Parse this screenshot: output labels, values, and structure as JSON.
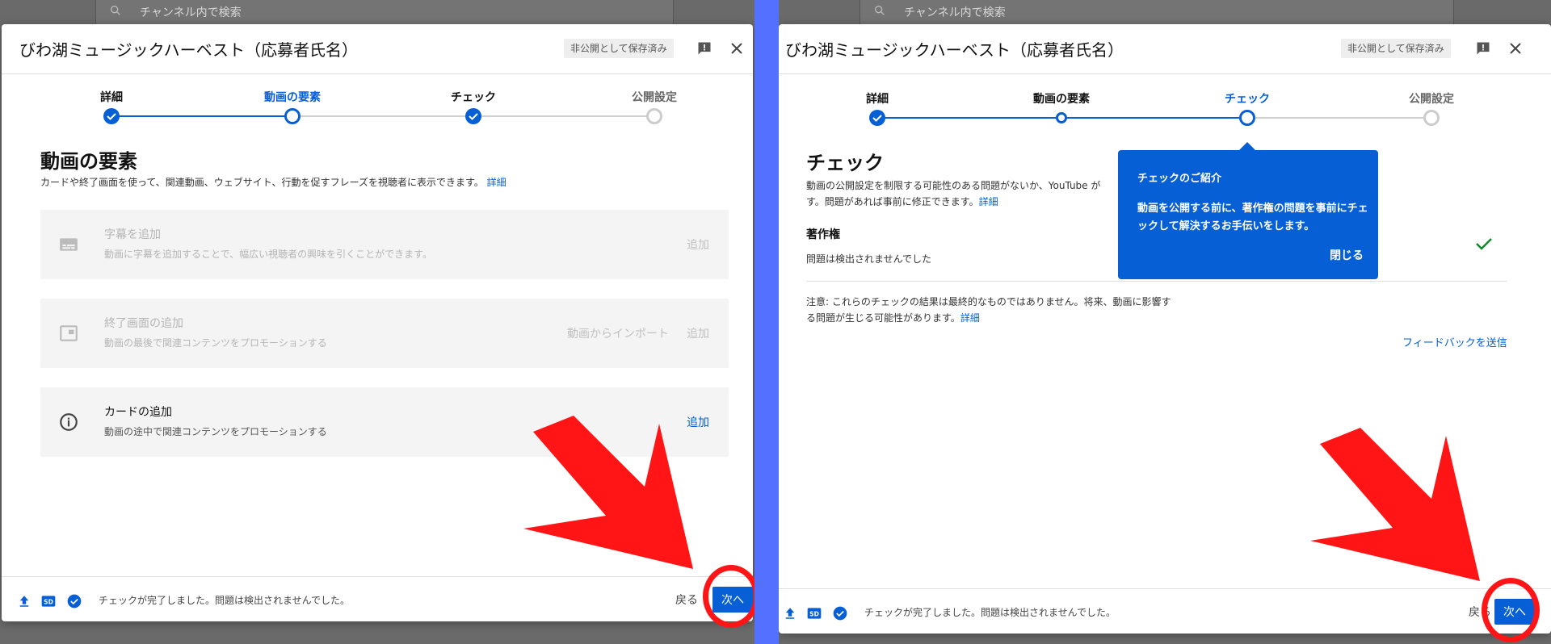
{
  "background": {
    "search_placeholder": "チャンネル内で検索"
  },
  "left": {
    "dialog_title": "びわ湖ミュージックハーベスト（応募者氏名）",
    "saved_badge": "非公開として保存済み",
    "steps": [
      {
        "label": "詳細",
        "state": "done"
      },
      {
        "label": "動画の要素",
        "state": "current"
      },
      {
        "label": "チェック",
        "state": "done"
      },
      {
        "label": "公開設定",
        "state": "pending"
      }
    ],
    "section_title": "動画の要素",
    "section_desc": "カードや終了画面を使って、関連動画、ウェブサイト、行動を促すフレーズを視聴者に表示できます。",
    "section_desc_link": "詳細",
    "cards": [
      {
        "title": "字幕を追加",
        "desc": "動画に字幕を追加することで、幅広い視聴者の興味を引くことができます。",
        "action": "追加",
        "secondary_action": "",
        "icon": "subtitles-icon",
        "enabled": false
      },
      {
        "title": "終了画面の追加",
        "desc": "動画の最後で関連コンテンツをプロモーションする",
        "action": "追加",
        "secondary_action": "動画からインポート",
        "icon": "end-screen-icon",
        "enabled": false
      },
      {
        "title": "カードの追加",
        "desc": "動画の途中で関連コンテンツをプロモーションする",
        "action": "追加",
        "secondary_action": "",
        "icon": "info-icon",
        "enabled": true
      }
    ],
    "footer_status": "チェックが完了しました。問題は検出されませんでした。",
    "back_label": "戻る",
    "next_label": "次へ"
  },
  "right": {
    "dialog_title": "びわ湖ミュージックハーベスト（応募者氏名）",
    "saved_badge": "非公開として保存済み",
    "steps": [
      {
        "label": "詳細",
        "state": "done"
      },
      {
        "label": "動画の要素",
        "state": "done-outline"
      },
      {
        "label": "チェック",
        "state": "current"
      },
      {
        "label": "公開設定",
        "state": "pending"
      }
    ],
    "section_title": "チェック",
    "section_desc_line1": "動画の公開設定を制限する可能性のある問題がないか、YouTube が",
    "section_desc_line2": "す。問題があれば事前に修正できます。",
    "section_desc_link": "詳細",
    "copyright_title": "著作権",
    "copyright_status": "問題は検出されませんでした",
    "note_line1": "注意: これらのチェックの結果は最終的なものではありません。将来、動画に影響す",
    "note_line2": "る問題が生じる可能性があります。",
    "note_link": "詳細",
    "feedback_link": "フィードバックを送信",
    "tooltip": {
      "title": "チェックのご紹介",
      "body": "動画を公開する前に、著作権の問題を事前にチェックして解決するお手伝いをします。",
      "close": "閉じる"
    },
    "footer_status": "チェックが完了しました。問題は検出されませんでした。",
    "back_label": "戻る",
    "next_label": "次へ"
  },
  "colors": {
    "accent": "#065fd4",
    "annotation_red": "#ff1515",
    "divider": "#5470ff"
  }
}
